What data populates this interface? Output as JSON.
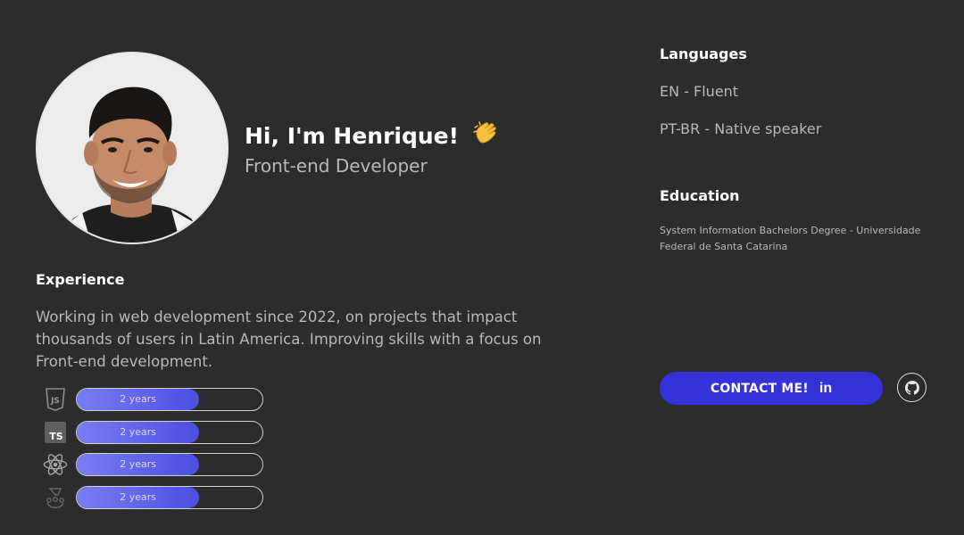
{
  "hero": {
    "greeting": "Hi, I'm Henrique!",
    "role": "Front-end Developer"
  },
  "experience": {
    "title": "Experience",
    "text": "Working in web development since 2022, on projects that impact thousands of users in Latin America. Improving skills with a focus on Front-end development.",
    "skills": [
      {
        "icon": "javascript-icon",
        "label": "2 years",
        "level": 0.66
      },
      {
        "icon": "typescript-icon",
        "label": "2 years",
        "level": 0.66
      },
      {
        "icon": "react-icon",
        "label": "2 years",
        "level": 0.66
      },
      {
        "icon": "jest-icon",
        "label": "2 years",
        "level": 0.66
      }
    ]
  },
  "languages": {
    "title": "Languages",
    "items": [
      "EN - Fluent",
      "PT-BR - Native speaker"
    ]
  },
  "education": {
    "title": "Education",
    "text": "System Information Bachelors Degree - Universidade Federal de Santa Catarina"
  },
  "contact": {
    "label": "CONTACT ME!",
    "linkedin_icon_text": "in"
  },
  "colors": {
    "background": "#2c2c2c",
    "accent": "#3432d8",
    "bar_gradient_start": "#7a7df2",
    "bar_gradient_end": "#4c4ee0"
  }
}
